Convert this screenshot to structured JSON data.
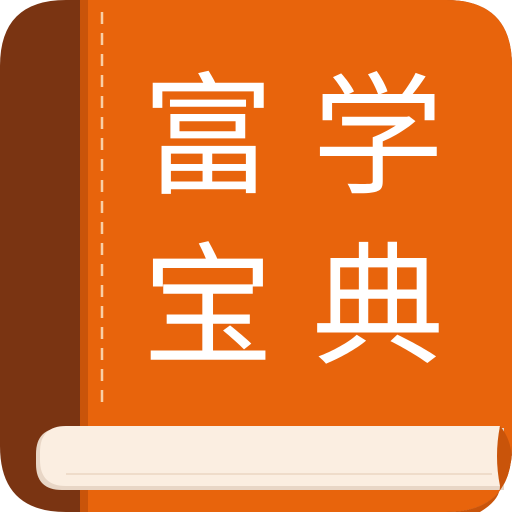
{
  "app_icon": {
    "title_chars": [
      "富",
      "学",
      "宝",
      "典"
    ],
    "colors": {
      "book_cover": "#e8640c",
      "book_spine": "#7a3412",
      "page_edge": "#fbeee1",
      "page_shadow": "#e8d6c6",
      "stitch": "#f9cfa6",
      "text": "#ffffff"
    },
    "icon_names": [
      "book-icon"
    ]
  }
}
